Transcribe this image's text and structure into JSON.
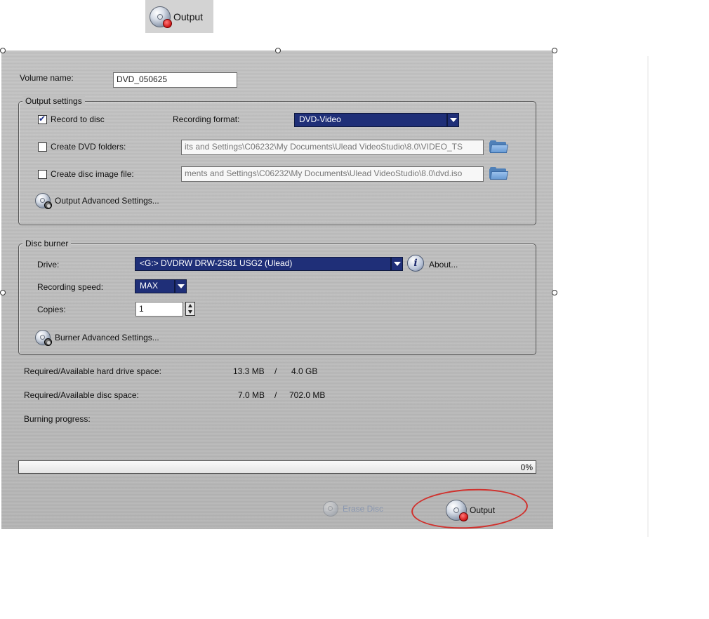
{
  "toolbar": {
    "output_label": "Output"
  },
  "dialog": {
    "volume_name": {
      "label": "Volume name:",
      "value": "DVD_050625"
    },
    "output_settings": {
      "title": "Output settings",
      "record_to_disc": {
        "label": "Record to disc",
        "checked": true
      },
      "recording_format": {
        "label": "Recording format:",
        "value": "DVD-Video"
      },
      "create_dvd_folders": {
        "label": "Create DVD folders:",
        "checked": false,
        "path": "its and Settings\\C06232\\My Documents\\Ulead VideoStudio\\8.0\\VIDEO_TS"
      },
      "create_disc_image": {
        "label": "Create disc image file:",
        "checked": false,
        "path": "ments and Settings\\C06232\\My Documents\\Ulead VideoStudio\\8.0\\dvd.iso"
      },
      "advanced_label": "Output Advanced Settings..."
    },
    "disc_burner": {
      "title": "Disc burner",
      "drive": {
        "label": "Drive:",
        "value": "<G:>  DVDRW DRW-2S81  USG2 (Ulead)"
      },
      "about_label": "About...",
      "recording_speed": {
        "label": "Recording speed:",
        "value": "MAX"
      },
      "copies": {
        "label": "Copies:",
        "value": "1"
      },
      "advanced_label": "Burner Advanced Settings..."
    },
    "space": {
      "hard_drive": {
        "label": "Required/Available hard drive space:",
        "required": "13.3 MB",
        "sep": "/",
        "available": "4.0 GB"
      },
      "disc": {
        "label": "Required/Available disc space:",
        "required": "7.0 MB",
        "sep": "/",
        "available": "702.0 MB"
      }
    },
    "burning_progress": {
      "label": "Burning progress:",
      "percent_text": "0%",
      "fraction": 0
    },
    "buttons": {
      "erase_disc": "Erase Disc",
      "output": "Output"
    }
  }
}
